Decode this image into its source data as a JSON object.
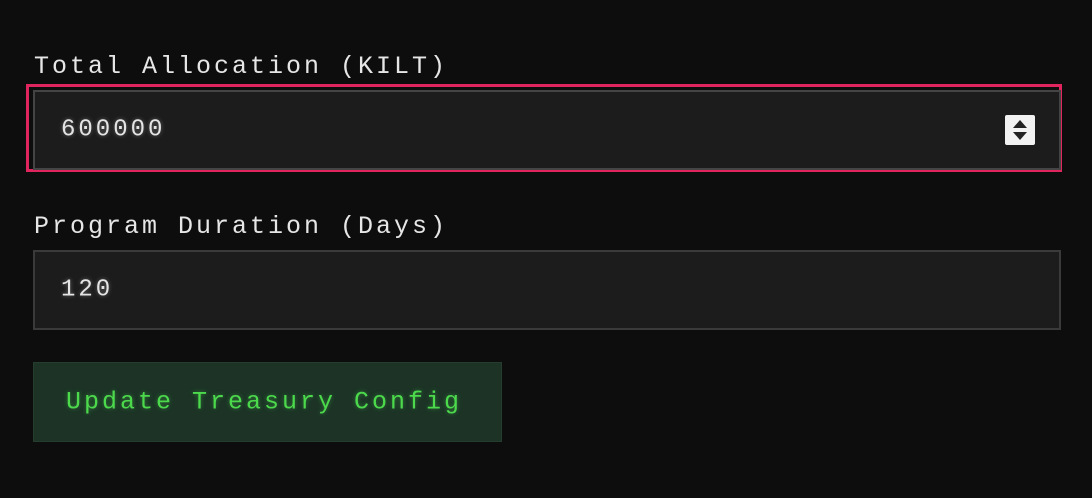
{
  "form": {
    "allocation": {
      "label": "Total Allocation (KILT)",
      "value": "600000"
    },
    "duration": {
      "label": "Program Duration (Days)",
      "value": "120"
    },
    "submit": {
      "label": "Update Treasury Config"
    }
  },
  "colors": {
    "background": "#0d0d0d",
    "focus_ring": "#e0245e",
    "button_text": "#4cd94c",
    "button_bg": "#1c3326"
  },
  "icons": {
    "spinner": "number-stepper-icon"
  }
}
